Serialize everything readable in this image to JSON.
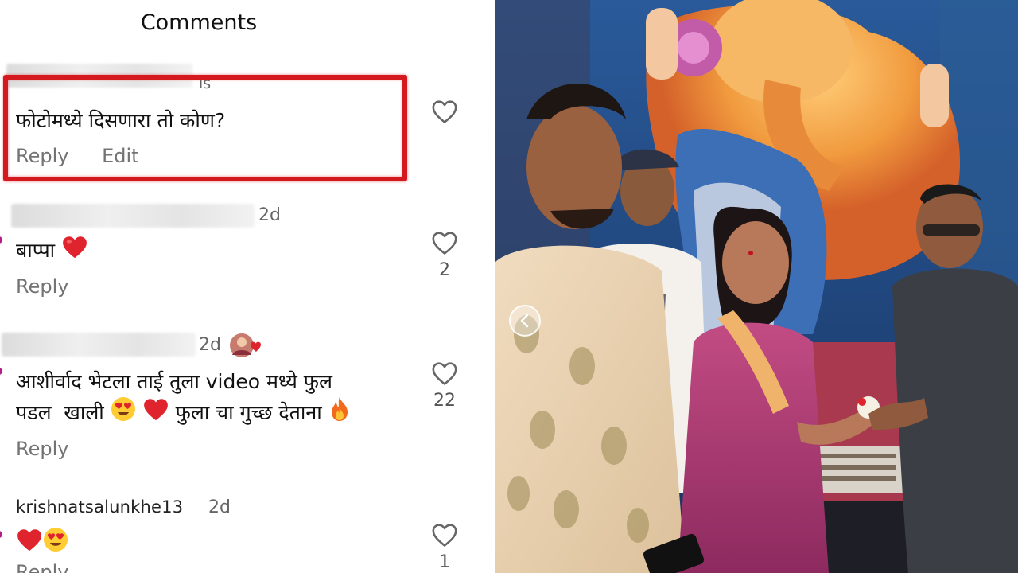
{
  "panel": {
    "title": "Comments"
  },
  "comments": [
    {
      "meta": "is",
      "text": "फोटोमध्ये दिसणारा तो कोण?",
      "actions": {
        "reply": "Reply",
        "edit": "Edit"
      }
    },
    {
      "time": "2d",
      "text": "बाप्पा",
      "actions": {
        "reply": "Reply"
      },
      "likes": "2"
    },
    {
      "time": "2d",
      "text_line1": "आशीर्वाद भेटला ताई तुला video मध्ये फुल",
      "text_line2_a": "पडल  खाली",
      "text_line2_b": "फुला चा गुच्छ देताना",
      "actions": {
        "reply": "Reply"
      },
      "likes": "22"
    },
    {
      "username": "krishnatsalunkhe13",
      "time": "2d",
      "actions": {
        "reply": "Reply"
      },
      "likes": "1"
    }
  ],
  "icons": {
    "like": "heart-outline-icon",
    "carousel_prev": "chevron-left-icon",
    "red_heart": "red-heart-emoji",
    "heart_eyes": "heart-eyes-emoji",
    "fire": "fire-emoji"
  },
  "colors": {
    "highlight": "#d41a1f",
    "secondary_text": "#737373",
    "heart": "#e0242e"
  }
}
